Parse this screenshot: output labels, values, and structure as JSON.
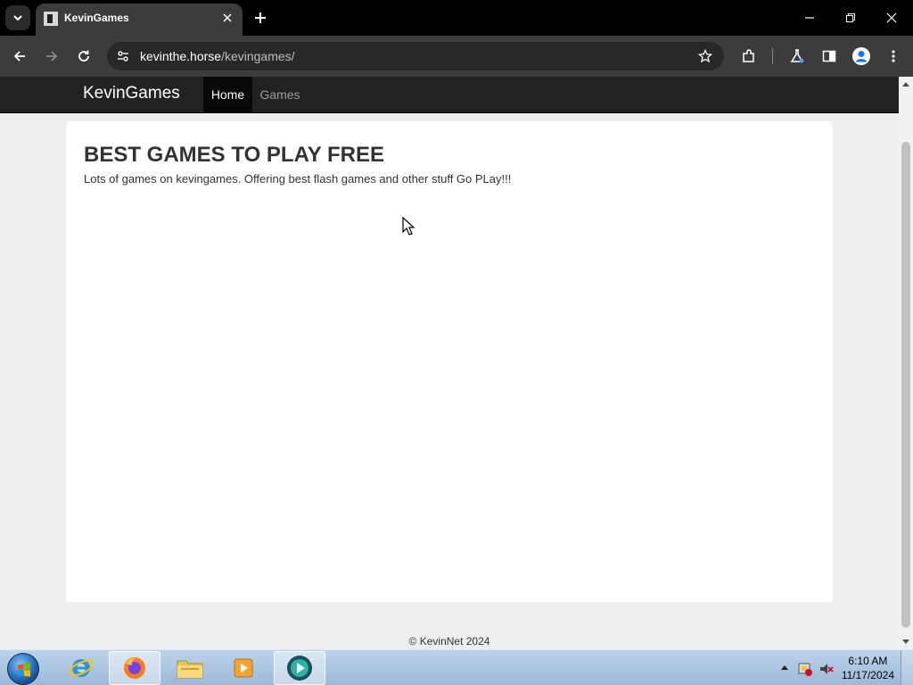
{
  "browser": {
    "tab": {
      "title": "KevinGames"
    },
    "address": {
      "host": "kevinthe.horse",
      "path": "/kevingames/"
    }
  },
  "site": {
    "brand": "KevinGames",
    "nav": {
      "home": "Home",
      "games": "Games"
    },
    "headline": "BEST GAMES TO PLAY FREE",
    "tagline": "Lots of games on kevingames. Offering best flash games and other stuff Go PLay!!!",
    "footer": "© KevinNet 2024"
  },
  "taskbar": {
    "apps": [
      "internet-explorer",
      "firefox",
      "file-explorer",
      "media-player",
      "active-browser"
    ],
    "clock": {
      "time": "6:10 AM",
      "date": "11/17/2024"
    }
  },
  "colors": {
    "nav_bg": "#222222",
    "nav_active_bg": "#080808",
    "page_bg": "#eeeeee",
    "text": "#333333"
  }
}
